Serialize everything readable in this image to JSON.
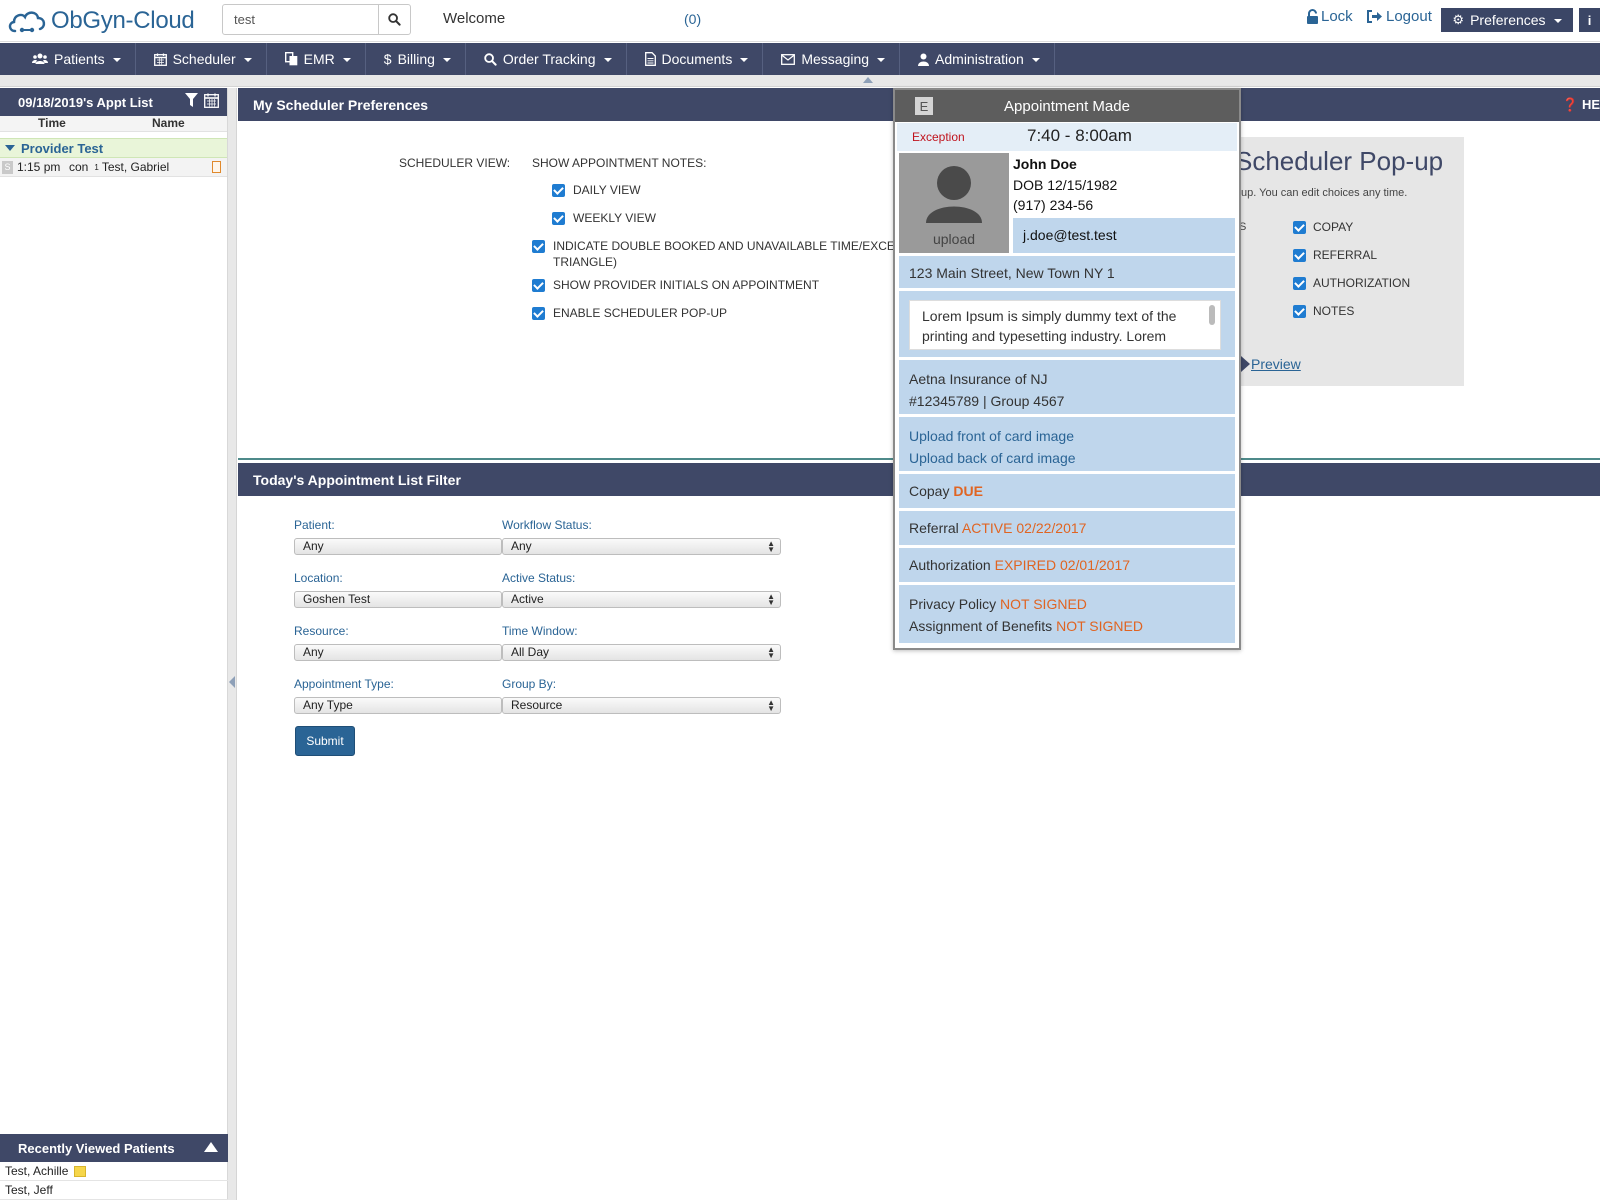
{
  "app": {
    "logo_main": "ObGyn",
    "logo_sep": "-",
    "logo_sub": "Cloud"
  },
  "header": {
    "search_value": "test",
    "welcome": "Welcome",
    "message_count": "(0)",
    "lock": "Lock",
    "logout": "Logout",
    "preferences": "Preferences"
  },
  "nav": {
    "items": [
      {
        "label": "Patients",
        "icon": "users-icon"
      },
      {
        "label": "Scheduler",
        "icon": "calendar-icon"
      },
      {
        "label": "EMR",
        "icon": "copy-icon"
      },
      {
        "label": "Billing",
        "icon": "dollar-icon"
      },
      {
        "label": "Order Tracking",
        "icon": "search-icon"
      },
      {
        "label": "Documents",
        "icon": "document-icon"
      },
      {
        "label": "Messaging",
        "icon": "envelope-icon"
      },
      {
        "label": "Administration",
        "icon": "user-icon"
      }
    ]
  },
  "sidebar": {
    "title": "09/18/2019's Appt List",
    "col_time": "Time",
    "col_name": "Name",
    "provider": "Provider Test",
    "appointment": {
      "status": "S",
      "time": "1:15 pm",
      "type": "con",
      "marker": "1",
      "name": "Test, Gabriel"
    },
    "recent_title": "Recently Viewed Patients",
    "recent": [
      "Test, Achille",
      "Test, Jeff"
    ]
  },
  "prefs": {
    "title": "My Scheduler Preferences",
    "help": "HE",
    "scheduler_view_label": "SCHEDULER VIEW:",
    "show_notes_label": "SHOW APPOINTMENT NOTES:",
    "daily": "DAILY VIEW",
    "weekly": "WEEKLY VIEW",
    "double_booked_line1": "INDICATE DOUBLE BOOKED AND UNAVAILABLE TIME/EXCEPTIO",
    "double_booked_line2": "TRIANGLE)",
    "initials": "SHOW PROVIDER INITIALS ON APPOINTMENT",
    "popup": "ENABLE SCHEDULER POP-UP"
  },
  "popup_settings": {
    "title": "Scheduler Pop-up",
    "subtitle": "up. You can edit choices any time.",
    "s_fragment": "S",
    "options": [
      "COPAY",
      "REFERRAL",
      "AUTHORIZATION",
      "NOTES"
    ],
    "preview": "Preview"
  },
  "filter": {
    "title": "Today's Appointment List Filter",
    "patient_label": "Patient:",
    "patient_value": "Any",
    "workflow_label": "Workflow Status:",
    "workflow_value": "Any",
    "location_label": "Location:",
    "location_value": "Goshen Test",
    "active_label": "Active Status:",
    "active_value": "Active",
    "resource_label": "Resource:",
    "resource_value": "Any",
    "time_label": "Time Window:",
    "time_value": "All Day",
    "type_label": "Appointment Type:",
    "type_value": "Any Type",
    "group_label": "Group By:",
    "group_value": "Resource",
    "submit": "Submit"
  },
  "appointment_popup": {
    "badge": "E",
    "title": "Appointment Made",
    "exception": "Exception",
    "time": "7:40 - 8:00am",
    "photo_upload": "upload",
    "name": "John Doe",
    "dob": "DOB 12/15/1982",
    "phone": "(917) 234-56",
    "email": "j.doe@test.test",
    "address": "123 Main Street, New Town NY 1",
    "notes": "Lorem Ipsum is simply dummy text of the printing and typesetting industry. Lorem",
    "insurance_name": "Aetna Insurance of NJ",
    "insurance_id": "#12345789 | Group 4567",
    "upload_front": "Upload front of card image",
    "upload_back": "Upload back of card image",
    "copay_label": "Copay",
    "copay_status": "DUE",
    "referral_label": "Referral",
    "referral_status": "ACTIVE 02/22/2017",
    "auth_label": "Authorization",
    "auth_status": "EXPIRED 02/01/2017",
    "privacy_label": "Privacy Policy",
    "privacy_status": "NOT SIGNED",
    "benefits_label": "Assignment of Benefits",
    "benefits_status": "NOT SIGNED"
  }
}
